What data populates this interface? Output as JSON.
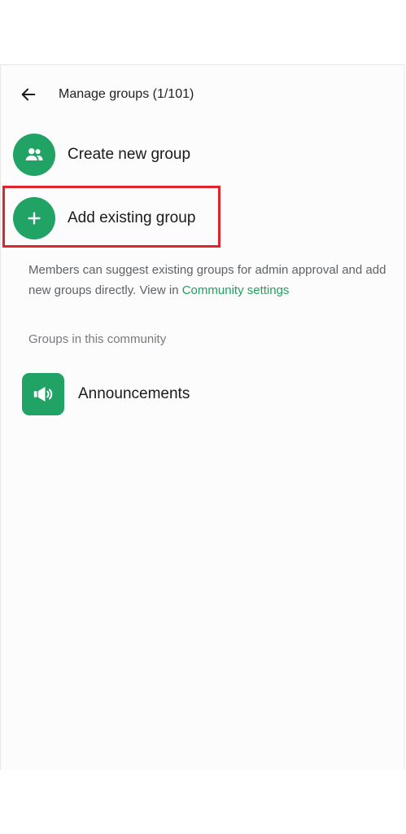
{
  "header": {
    "title": "Manage groups (1/101)",
    "back_icon": "arrow-left-icon"
  },
  "actions": [
    {
      "label": "Create new group",
      "icon": "people-icon"
    },
    {
      "label": "Add existing group",
      "icon": "plus-icon"
    }
  ],
  "info": {
    "text": "Members can suggest existing groups for admin approval and add new groups directly. View in",
    "link": "Community settings"
  },
  "section": {
    "label": "Groups in this community"
  },
  "groups": [
    {
      "label": "Announcements",
      "icon": "megaphone-icon"
    }
  ],
  "colors": {
    "accent": "#21a366",
    "link": "#1ea25c",
    "highlight": "#e0242c"
  }
}
